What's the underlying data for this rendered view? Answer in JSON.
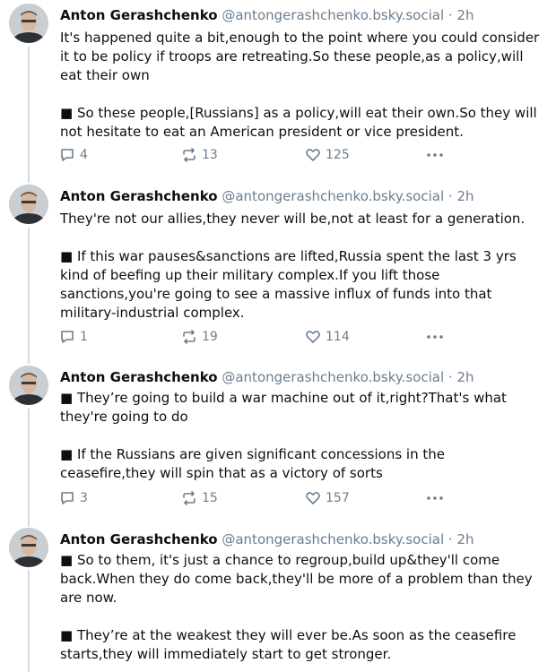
{
  "posts": [
    {
      "name": "Anton Gerashchenko",
      "handle": "@antongerashchenko.bsky.social",
      "time": "· 2h",
      "paragraphs": [
        "It's happened quite a bit,enough to the point where you could consider it to be policy if troops are retreating.So these people,as a policy,will eat  their own",
        "■ So these people,[Russians] as a policy,will eat their own.So they will not hesitate to eat an American president or vice president."
      ],
      "replies": "4",
      "reposts": "13",
      "likes": "125"
    },
    {
      "name": "Anton Gerashchenko",
      "handle": "@antongerashchenko.bsky.social",
      "time": "· 2h",
      "paragraphs": [
        "They're not our allies,they never will be,not at least for a generation.",
        "■ If this war pauses&sanctions are lifted,Russia spent the last 3 yrs kind of beefing up their military complex.If you lift those sanctions,you're going to see a massive influx of funds into  that military-industrial complex."
      ],
      "replies": "1",
      "reposts": "19",
      "likes": "114"
    },
    {
      "name": "Anton Gerashchenko",
      "handle": "@antongerashchenko.bsky.social",
      "time": "· 2h",
      "paragraphs": [
        "■ They’re going to build a war machine out of it,right?That's what they're going to do",
        "■ If the Russians are given significant concessions in the ceasefire,they will spin that as a victory of sorts"
      ],
      "replies": "3",
      "reposts": "15",
      "likes": "157"
    },
    {
      "name": "Anton Gerashchenko",
      "handle": "@antongerashchenko.bsky.social",
      "time": "· 2h",
      "paragraphs": [
        "■ So to them, it's just a chance to regroup,build up&they'll come back.When they do come back,they'll be more of a problem than they are now.",
        "■ They’re at the weakest they will ever be.As soon as the ceasefire starts,they will immediately start to get stronger."
      ]
    }
  ],
  "icons": {
    "reply": "reply-icon",
    "repost": "repost-icon",
    "like": "heart-icon",
    "more": "more-dots-icon"
  },
  "colors": {
    "text": "#0b0f14",
    "muted": "#6a7d8f",
    "thread_line": "#d4dbe2"
  }
}
